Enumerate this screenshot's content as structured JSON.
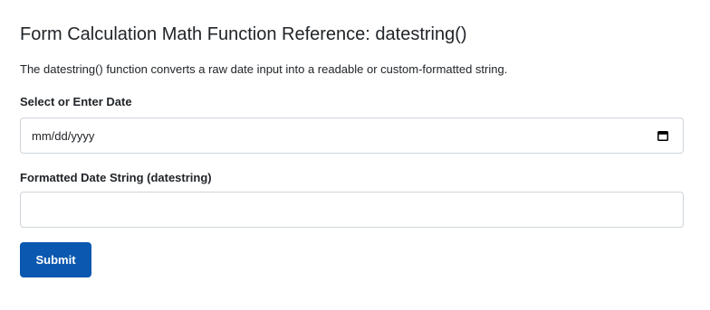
{
  "page": {
    "title": "Form Calculation Math Function Reference: datestring()",
    "description": "The datestring() function converts a raw date input into a readable or custom-formatted string."
  },
  "form": {
    "date_label": "Select or Enter Date",
    "date_placeholder": "mm/dd/yyyy",
    "date_icon": "calendar-icon",
    "output_label": "Formatted Date String (datestring)",
    "output_value": "",
    "submit_label": "Submit"
  },
  "colors": {
    "accent": "#0a58b0",
    "text": "#212529",
    "border": "#ced4da"
  }
}
